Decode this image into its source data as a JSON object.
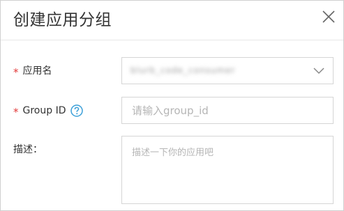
{
  "dialog": {
    "title": "创建应用分组"
  },
  "form": {
    "app_name": {
      "label": "应用名",
      "required_mark": "*",
      "value": "blurb_code_consumer"
    },
    "group_id": {
      "label": "Group ID",
      "required_mark": "*",
      "help_icon": "question-circle-icon",
      "placeholder": "请输入group_id"
    },
    "description": {
      "label": "描述：",
      "placeholder": "描述一下你的应用吧"
    }
  },
  "colors": {
    "required": "#e23b3b",
    "help_icon": "#3a9fd8",
    "border": "#d5d5d5",
    "placeholder": "#b5b5b5"
  }
}
